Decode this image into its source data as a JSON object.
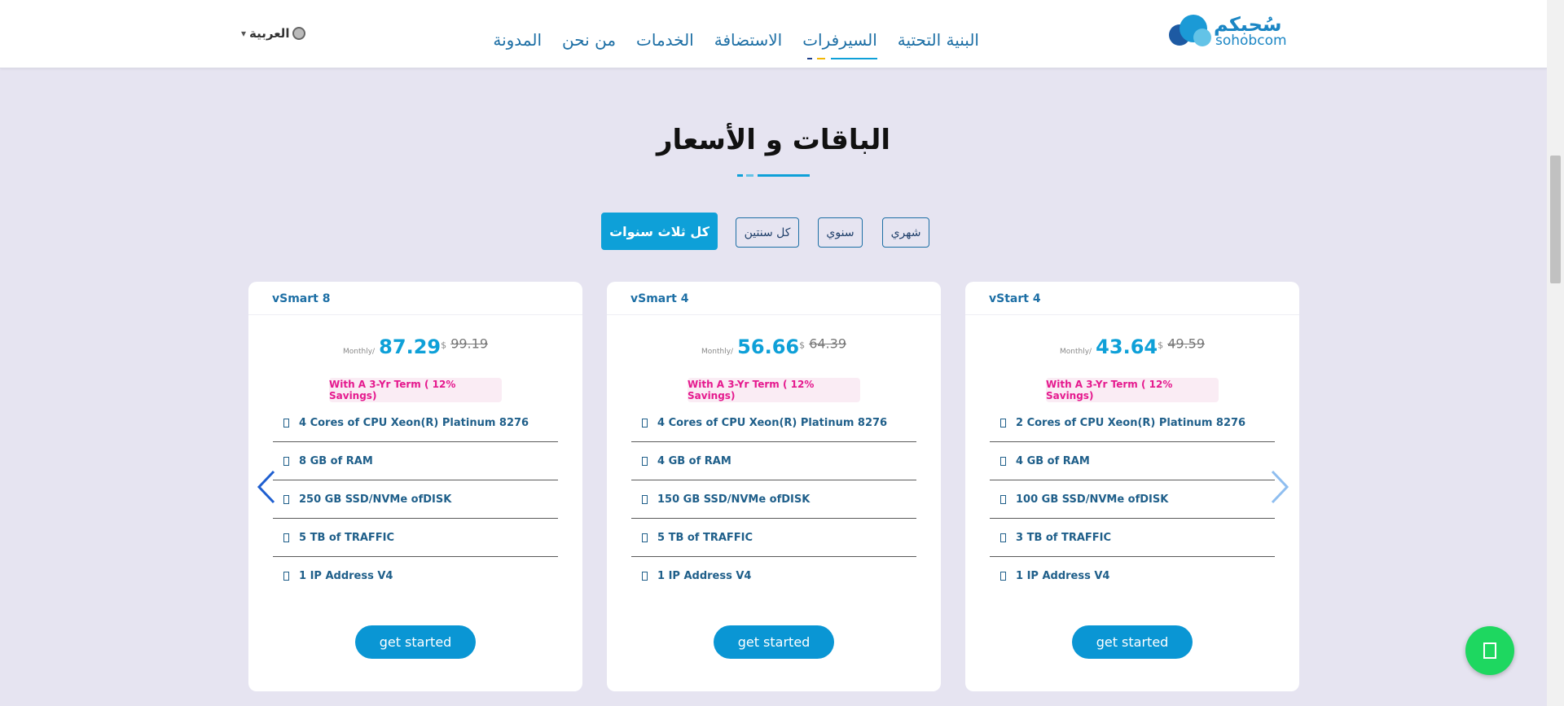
{
  "header": {
    "logo_ar": "سُحبكم",
    "logo_en": "sohobcom",
    "nav": [
      {
        "label": "البنية التحتية"
      },
      {
        "label": "السيرفرات",
        "active": true
      },
      {
        "label": "الاستضافة"
      },
      {
        "label": "الخدمات"
      },
      {
        "label": "من نحن"
      },
      {
        "label": "المدونة"
      }
    ],
    "language": "العربية",
    "language_icon": "globe-icon"
  },
  "section": {
    "title": "الباقات و الأسعار"
  },
  "tabs": [
    {
      "label": "شهري"
    },
    {
      "label": "سنوي"
    },
    {
      "label": "كل سنتين"
    },
    {
      "label": "كل ثلاث سنوات",
      "active": true
    }
  ],
  "cards": [
    {
      "name": "vStart 4",
      "monthly_label": "Monthly/",
      "price": "43.64",
      "currency": "$",
      "old_price": "49.59",
      "savings": "With A 3-Yr Term ( 12% Savings)",
      "features": [
        "2 Cores of CPU Xeon(R) Platinum 8276",
        "4 GB of RAM",
        "100 GB SSD/NVMe ofDISK",
        "3 TB of TRAFFIC",
        "1 IP Address V4"
      ],
      "button": "get started"
    },
    {
      "name": "vSmart 4",
      "monthly_label": "Monthly/",
      "price": "56.66",
      "currency": "$",
      "old_price": "64.39",
      "savings": "With A 3-Yr Term ( 12% Savings)",
      "features": [
        "4 Cores of CPU Xeon(R) Platinum 8276",
        "4 GB of RAM",
        "150 GB SSD/NVMe ofDISK",
        "5 TB of TRAFFIC",
        "1 IP Address V4"
      ],
      "button": "get started"
    },
    {
      "name": "vSmart 8",
      "monthly_label": "Monthly/",
      "price": "87.29",
      "currency": "$",
      "old_price": "99.19",
      "savings": "With A 3-Yr Term ( 12% Savings)",
      "features": [
        "4 Cores of CPU Xeon(R) Platinum 8276",
        "8 GB of RAM",
        "250 GB SSD/NVMe ofDISK",
        "5 TB of TRAFFIC",
        "1 IP Address V4"
      ],
      "button": "get started"
    }
  ],
  "colors": {
    "accent": "#0ea0d8",
    "nav_text": "#1d6fa5",
    "savings_text": "#e5198e",
    "whatsapp": "#1ed760",
    "background": "#e6e4f1"
  },
  "icons": {
    "prev": "chevron-left-icon",
    "next": "chevron-right-icon",
    "chat": "whatsapp-icon"
  }
}
